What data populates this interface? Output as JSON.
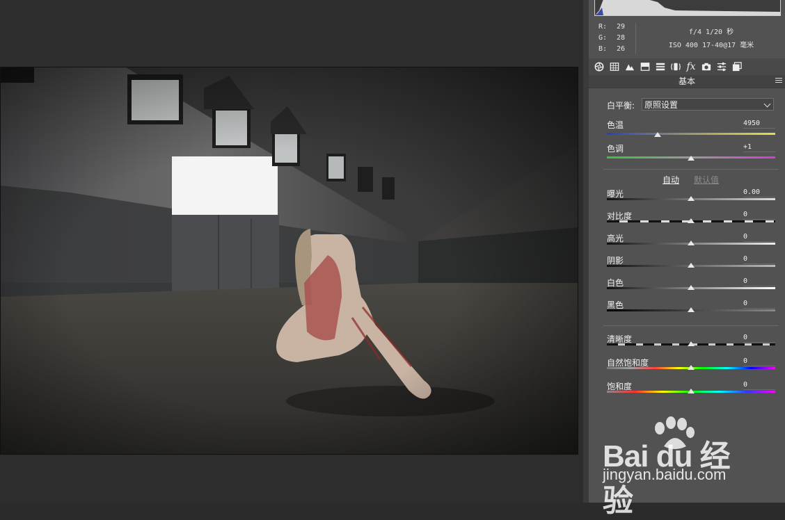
{
  "info": {
    "rgb": [
      {
        "label": "R:",
        "value": "29"
      },
      {
        "label": "G:",
        "value": "28"
      },
      {
        "label": "B:",
        "value": "26"
      }
    ],
    "exif_line1": "f/4  1/20 秒",
    "exif_line2": "ISO 400  17-40@17 毫米"
  },
  "toolbar": {
    "icons": [
      "aperture-icon",
      "tone-curve-grid-icon",
      "mountains-icon",
      "split-tone-icon",
      "hsl-bars-icon",
      "lens-icon",
      "fx-icon",
      "camera-icon",
      "sliders-icon",
      "presets-stack-icon"
    ],
    "fx_label": "fx"
  },
  "section": {
    "title": "基本"
  },
  "white_balance": {
    "label": "白平衡:",
    "value": "原照设置"
  },
  "temp": {
    "label": "色温",
    "value": "4950",
    "position": 0.3
  },
  "tint": {
    "label": "色调",
    "value": "+1",
    "position": 0.5
  },
  "auto": {
    "auto_label": "自动",
    "default_label": "默认值"
  },
  "tone": [
    {
      "id": "exposure",
      "label": "曝光",
      "value": "0.00",
      "position": 0.5
    },
    {
      "id": "contrast",
      "label": "对比度",
      "value": "0",
      "position": 0.5
    },
    {
      "id": "highlights",
      "label": "高光",
      "value": "0",
      "position": 0.5
    },
    {
      "id": "shadows",
      "label": "阴影",
      "value": "0",
      "position": 0.5
    },
    {
      "id": "whites",
      "label": "白色",
      "value": "0",
      "position": 0.5
    },
    {
      "id": "blacks",
      "label": "黑色",
      "value": "0",
      "position": 0.5
    }
  ],
  "presence": [
    {
      "id": "clarity",
      "label": "清晰度",
      "value": "0",
      "position": 0.5
    },
    {
      "id": "vibrance",
      "label": "自然饱和度",
      "value": "0",
      "position": 0.5
    },
    {
      "id": "saturation",
      "label": "饱和度",
      "value": "0",
      "position": 0.5
    }
  ],
  "watermark": {
    "logo": "Bai du 经验",
    "url": "jingyan.baidu.com"
  }
}
